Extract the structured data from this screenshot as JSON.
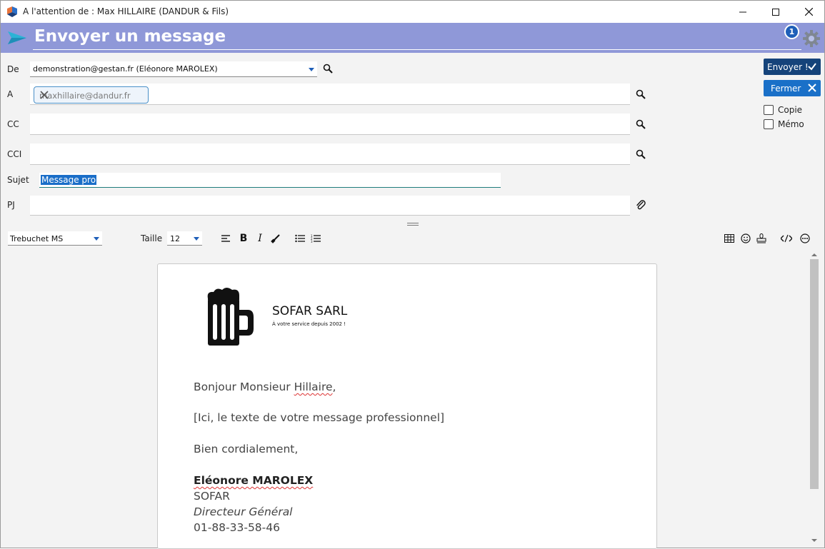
{
  "window": {
    "title": "A l'attention de : Max HILLAIRE (DANDUR & Fils)"
  },
  "header": {
    "title": "Envoyer un message",
    "badge_count": "1"
  },
  "form": {
    "from_label": "De",
    "from_value": "demonstration@gestan.fr  (Eléonore MAROLEX)",
    "to_label": "A",
    "to_chip": "maxhillaire@dandur.fr",
    "cc_label": "CC",
    "bcc_label": "CCI",
    "subject_label": "Sujet",
    "subject_value": "Message pro",
    "attach_label": "PJ"
  },
  "actions": {
    "send_label": "Envoyer !",
    "close_label": "Fermer",
    "copy_label": "Copie",
    "memo_label": "Mémo"
  },
  "toolbar": {
    "font_value": "Trebuchet MS",
    "size_label": "Taille",
    "size_value": "12"
  },
  "message": {
    "company": "SOFAR SARL",
    "tagline": "À votre service depuis 2002 !",
    "greeting_prefix": "Bonjour Monsieur ",
    "greeting_name": "Hillaire",
    "greeting_suffix": ",",
    "body": "[Ici, le texte de votre message professionnel]",
    "closing": "Bien cordialement,",
    "sig_name": "Eléonore MAROLEX",
    "sig_company": "SOFAR",
    "sig_title": "Directeur Général",
    "sig_phone": "01-88-33-58-46"
  },
  "colors": {
    "header_bg": "#8f98d8",
    "send_button": "#15437a",
    "close_button": "#1a70c8",
    "accent": "#1f5fb8"
  }
}
